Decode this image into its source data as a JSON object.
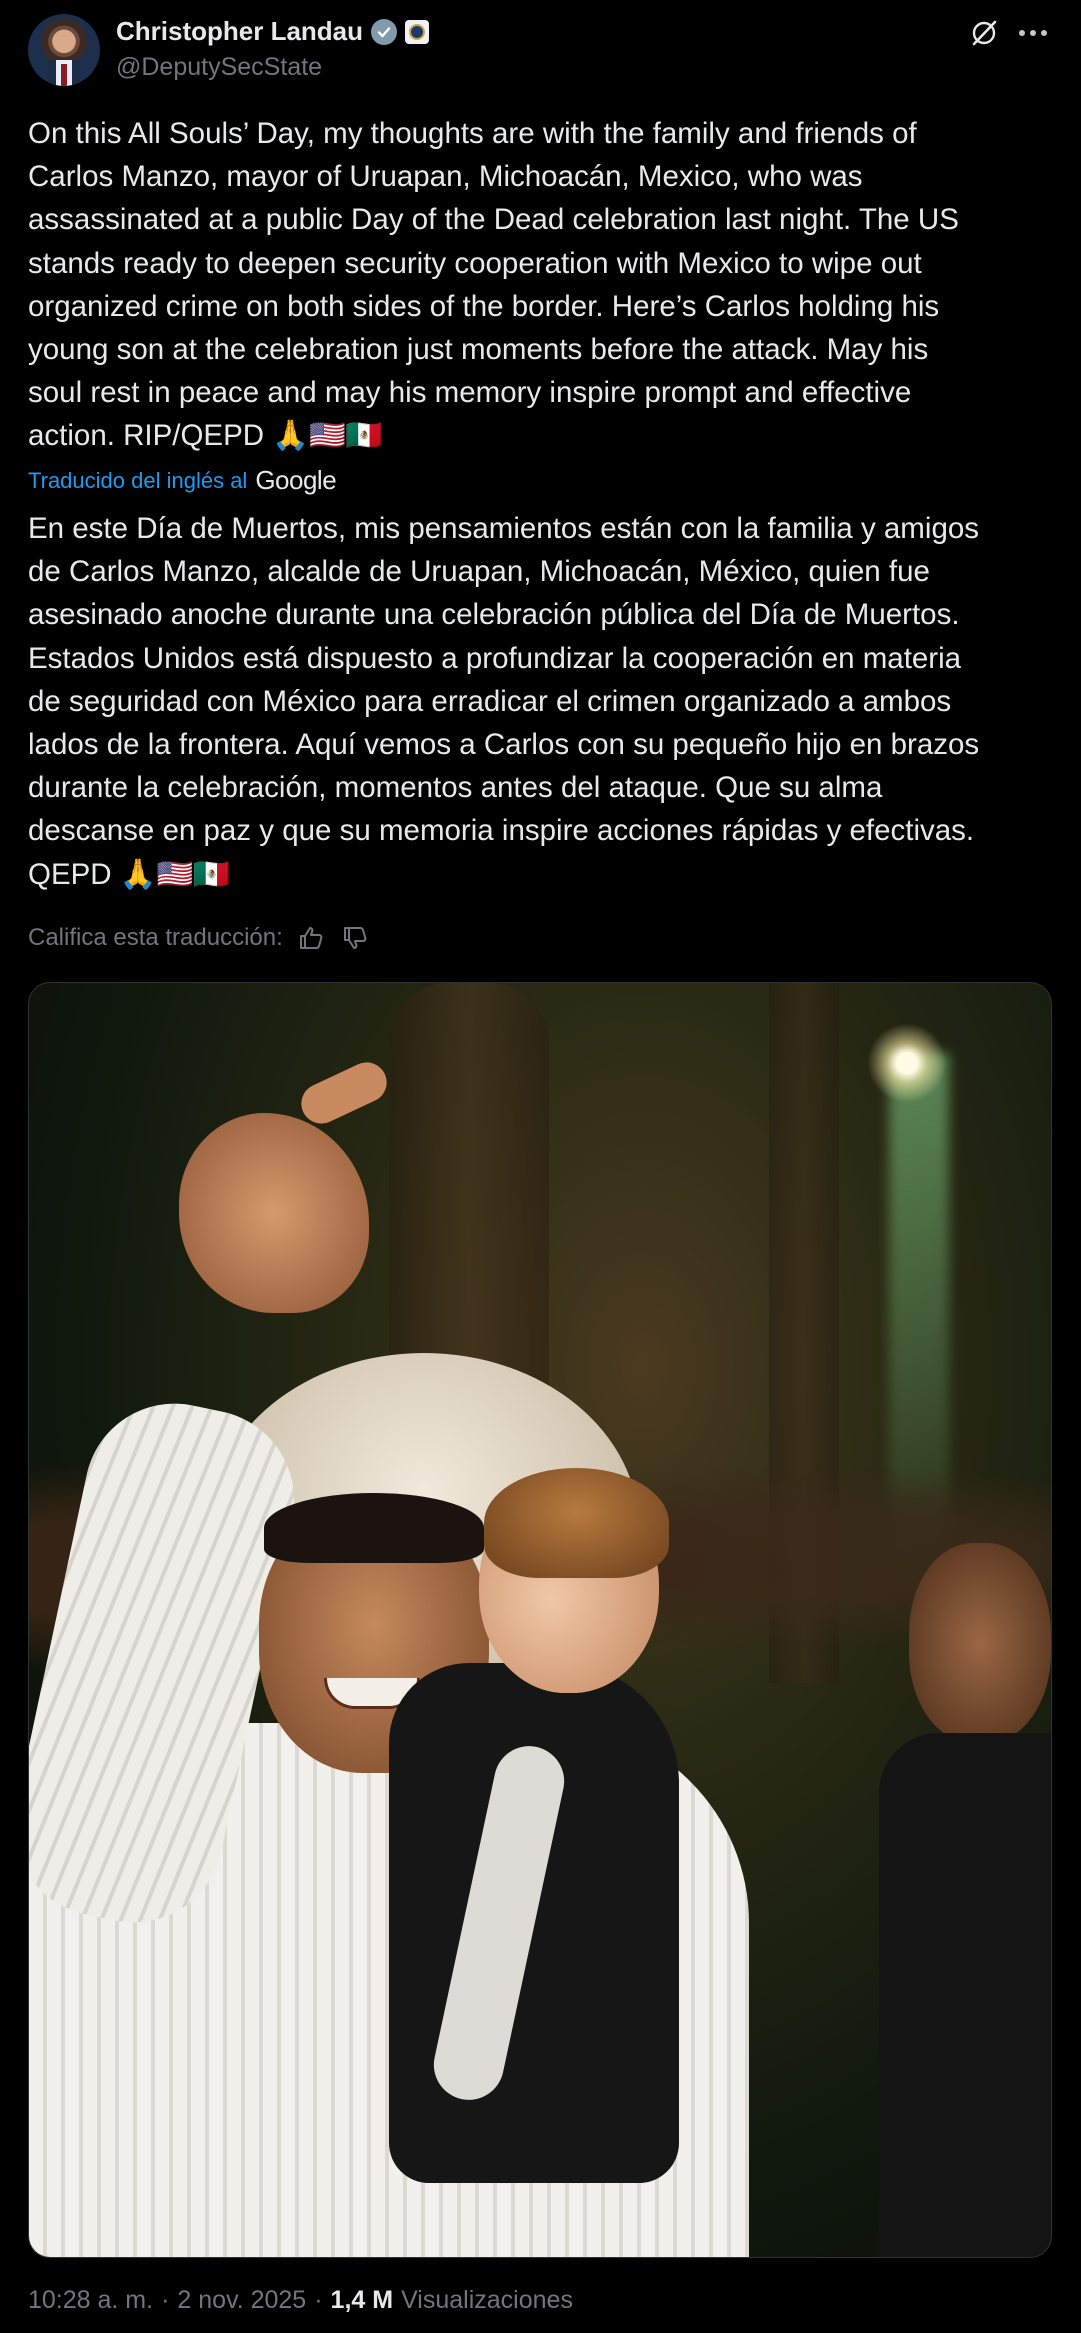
{
  "author": {
    "name": "Christopher Landau",
    "handle": "@DeputySecState"
  },
  "tweet": {
    "text": "On this All Souls’ Day, my thoughts are with the family and friends of\nCarlos Manzo, mayor of Uruapan, Michoacán, Mexico, who was\nassassinated at a public Day of the Dead celebration last night. The US\nstands ready to deepen security cooperation with Mexico to wipe out\norganized crime on both sides of the border. Here’s Carlos holding his\nyoung son at the celebration just moments before the attack. May his\nsoul rest in peace and may his memory inspire prompt and effective\naction. RIP/QEPD 🙏🇺🇸🇲🇽"
  },
  "translation": {
    "label": "Traducido del inglés al",
    "provider": "Google",
    "text": "En este Día de Muertos, mis pensamientos están con la familia y amigos\nde Carlos Manzo, alcalde de Uruapan, Michoacán, México, quien fue\nasesinado anoche durante una celebración pública del Día de Muertos.\nEstados Unidos está dispuesto a profundizar la cooperación en materia\nde seguridad con México para erradicar el crimen organizado a ambos\nlados de la frontera. Aquí vemos a Carlos con su pequeño hijo en brazos\ndurante la celebración, momentos antes del ataque. Que su alma\ndescanse en paz y que su memoria inspire acciones rápidas y efectivas.\nQEPD 🙏🇺🇸🇲🇽",
    "rate_label": "Califica esta traducción:"
  },
  "meta": {
    "time": "10:28 a. m.",
    "separator": "·",
    "date": "2 nov. 2025",
    "views_count": "1,4 M",
    "views_label": "Visualizaciones"
  },
  "icons": {
    "verified": "verified-badge-icon",
    "affiliate": "government-seal-icon",
    "grok": "grok-icon",
    "more": "more-horizontal-icon",
    "thumbs_up": "thumbs-up-icon",
    "thumbs_down": "thumbs-down-icon"
  },
  "colors": {
    "background": "#000000",
    "text": "#e7e9ea",
    "secondary": "#71767b",
    "link": "#1d9bf0",
    "verified": "#829aab"
  }
}
